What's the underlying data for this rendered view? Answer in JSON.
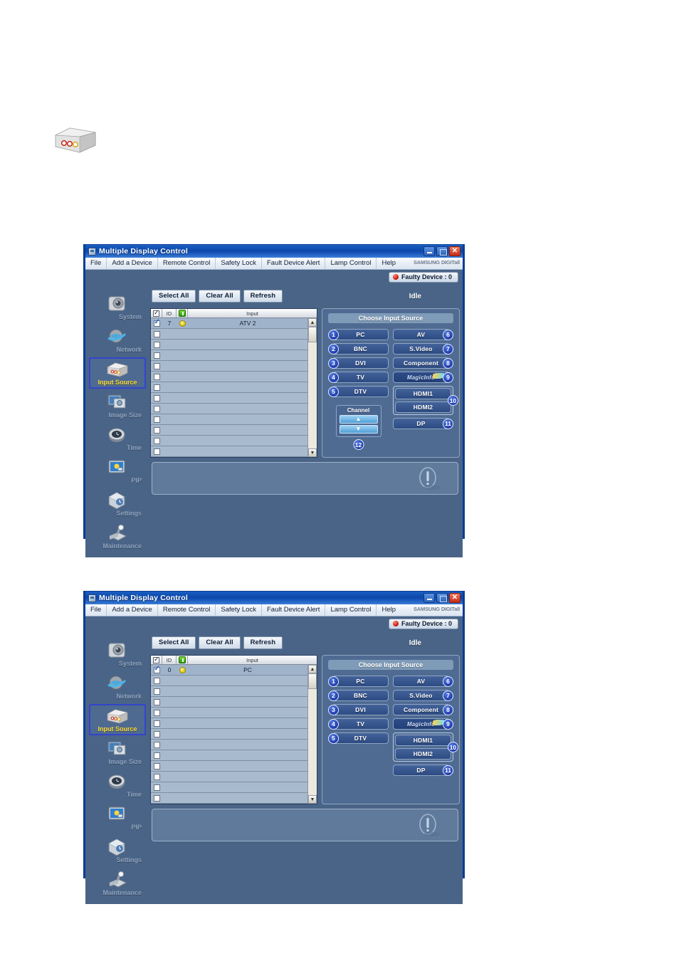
{
  "page": {
    "top_icon_name": "input-source-device-icon"
  },
  "window": {
    "title": "Multiple Display Control",
    "brand": "SAMSUNG DIGITall",
    "menu": [
      "File",
      "Add a Device",
      "Remote Control",
      "Safety Lock",
      "Fault Device Alert",
      "Lamp Control",
      "Help"
    ],
    "faulty_device": "Faulty Device : 0",
    "window_buttons": {
      "minimize": "minimize-button",
      "maximize": "maximize-button",
      "close": "✕"
    }
  },
  "sidebar": {
    "items": [
      {
        "label": "System",
        "icon": "system-icon",
        "selected": false
      },
      {
        "label": "Network",
        "icon": "network-globe-icon",
        "selected": false
      },
      {
        "label": "Input Source",
        "icon": "input-source-icon",
        "selected": true
      },
      {
        "label": "Image Size",
        "icon": "image-size-icon",
        "selected": false
      },
      {
        "label": "Time",
        "icon": "clock-icon",
        "selected": false
      },
      {
        "label": "PIP",
        "icon": "pip-icon",
        "selected": false
      },
      {
        "label": "Settings",
        "icon": "settings-cube-icon",
        "selected": false
      },
      {
        "label": "Maintenance",
        "icon": "maintenance-icon",
        "selected": false
      }
    ]
  },
  "toolbar": {
    "select_all": "Select All",
    "clear_all": "Clear All",
    "refresh": "Refresh",
    "status": "Idle"
  },
  "table": {
    "headers": {
      "check": "checkbox-header",
      "id": "ID",
      "power": "power-header",
      "input": "Input"
    },
    "rows_win1": [
      {
        "checked": true,
        "id": "7",
        "power": "on",
        "input": "ATV 2"
      }
    ],
    "rows_win2": [
      {
        "checked": true,
        "id": "0",
        "power": "on",
        "input": "PC"
      }
    ],
    "empty_row_count": 11
  },
  "input_source": {
    "title": "Choose Input Source",
    "left_buttons": [
      {
        "num": "1",
        "label": "PC"
      },
      {
        "num": "2",
        "label": "BNC"
      },
      {
        "num": "3",
        "label": "DVI"
      },
      {
        "num": "4",
        "label": "TV"
      },
      {
        "num": "5",
        "label": "DTV"
      }
    ],
    "right_buttons": [
      {
        "num": "6",
        "label": "AV"
      },
      {
        "num": "7",
        "label": "S.Video"
      },
      {
        "num": "8",
        "label": "Component"
      },
      {
        "num": "9",
        "label": "MagicInfo"
      }
    ],
    "hdmi_group": {
      "num": "10",
      "buttons": [
        {
          "label": "HDMI1"
        },
        {
          "label": "HDMI2"
        }
      ]
    },
    "dp_button": {
      "num": "11",
      "label": "DP"
    },
    "channel": {
      "num": "12",
      "title": "Channel",
      "up": "▲",
      "down": "▼"
    }
  },
  "info_panel": {
    "icon": "exclamation-circle-icon",
    "text": ""
  },
  "colors": {
    "window_body": "#4a6487",
    "panel": "#5a7296",
    "titlebar_blue": "#0d48a8",
    "selected_label": "#ffd92e",
    "fault_red": "#c01000",
    "power_green": "#2f9a10",
    "status_yellow": "#dcc400",
    "button_blue": "#2d4c84",
    "number_badge": "#1b35a8"
  }
}
